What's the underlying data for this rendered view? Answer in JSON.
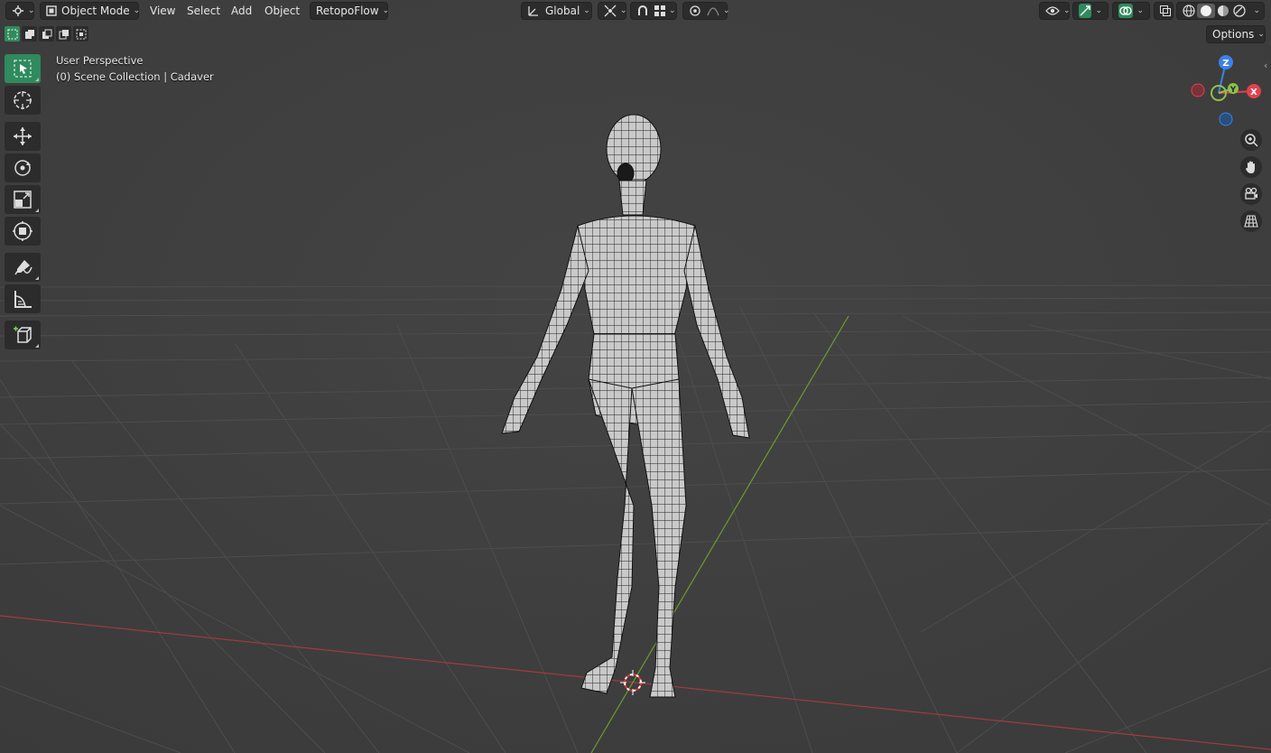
{
  "header": {
    "mode_label": "Object Mode",
    "menus": [
      "View",
      "Select",
      "Add",
      "Object"
    ],
    "addon_label": "RetopoFlow",
    "orientation_label": "Global",
    "options_label": "Options"
  },
  "overlay": {
    "view_name": "User Perspective",
    "collection_info": "(0) Scene Collection | Cadaver"
  },
  "gizmo": {
    "z_label": "Z",
    "y_label": "Y",
    "x_label": "X"
  },
  "colors": {
    "active_tool": "#2f8a5e",
    "x_axis": "#e1424f",
    "y_axis": "#8bc34a",
    "z_axis": "#3b82e6",
    "background": "#3d3d3d"
  },
  "icons": {
    "editor_type": "editor-type-icon",
    "select_box": "select-box-icon",
    "cursor": "cursor-icon",
    "move": "move-icon",
    "rotate": "rotate-icon",
    "scale": "scale-icon",
    "transform": "transform-icon",
    "annotate": "annotate-icon",
    "measure": "measure-icon",
    "add_cube": "add-cube-icon",
    "zoom": "zoom-icon",
    "pan": "hand-icon",
    "camera": "camera-icon",
    "perspective": "grid-icon"
  }
}
